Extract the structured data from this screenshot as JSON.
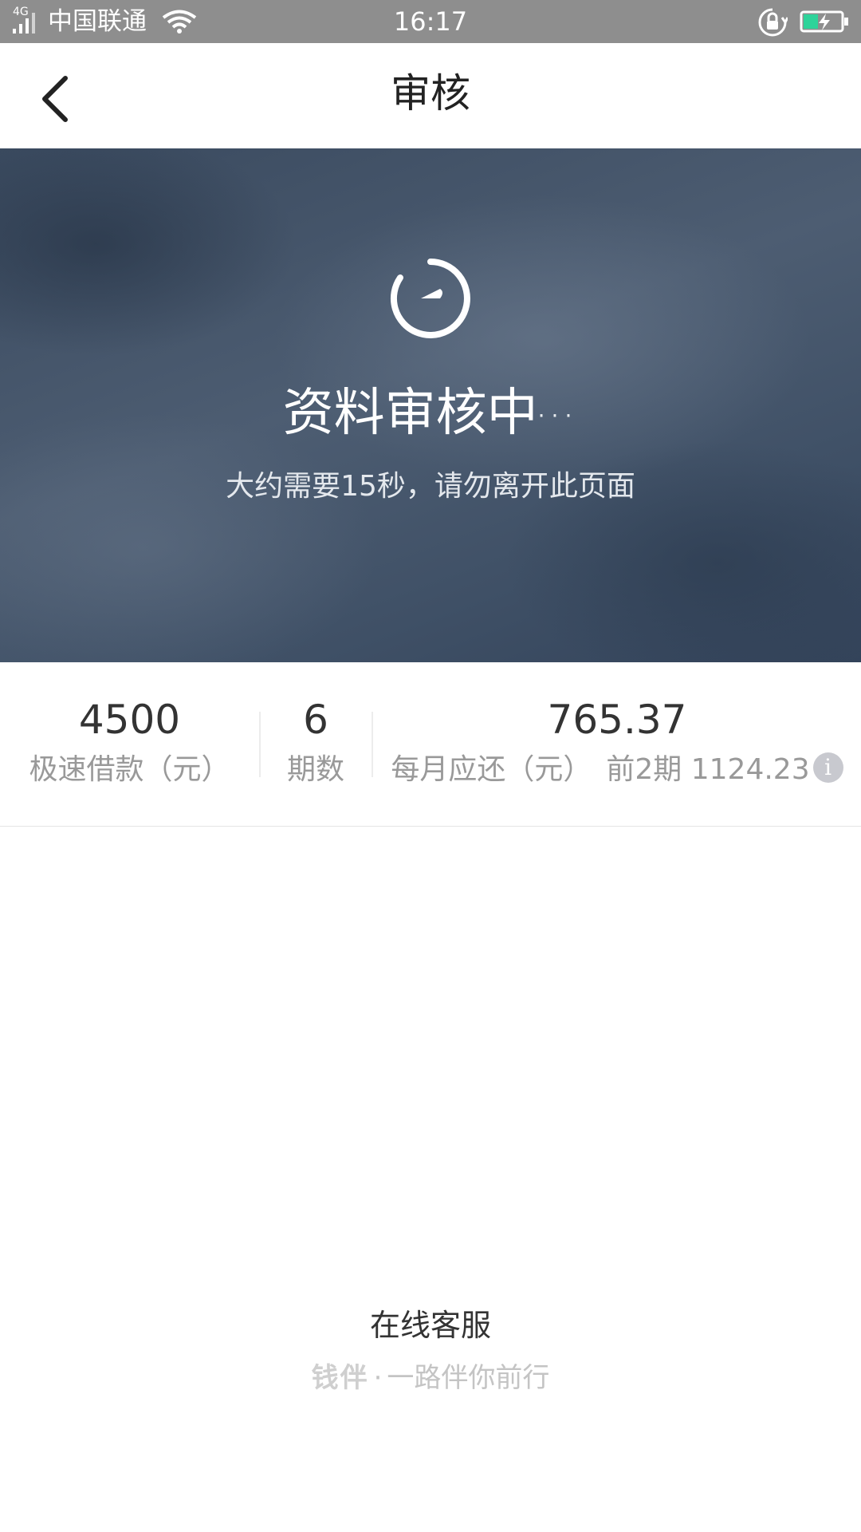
{
  "status_bar": {
    "network_type": "4G",
    "carrier": "中国联通",
    "time": "16:17",
    "battery_color": "#2ed39a"
  },
  "nav": {
    "title": "审核",
    "back_icon": "chevron-left-icon"
  },
  "hero": {
    "icon": "timer-icon",
    "title": "资料审核中",
    "dots": "···",
    "subtitle": "大约需要15秒，请勿离开此页面"
  },
  "summary": {
    "loan_amount": "4500",
    "loan_label": "极速借款（元）",
    "periods": "6",
    "periods_label": "期数",
    "monthly_amount": "765.37",
    "monthly_label": "每月应还（元）",
    "first_periods_note": "前2期 1124.23",
    "info_icon": "i"
  },
  "footer": {
    "service_label": "在线客服",
    "brand": "钱伴",
    "separator": "·",
    "slogan": "一路伴你前行"
  }
}
